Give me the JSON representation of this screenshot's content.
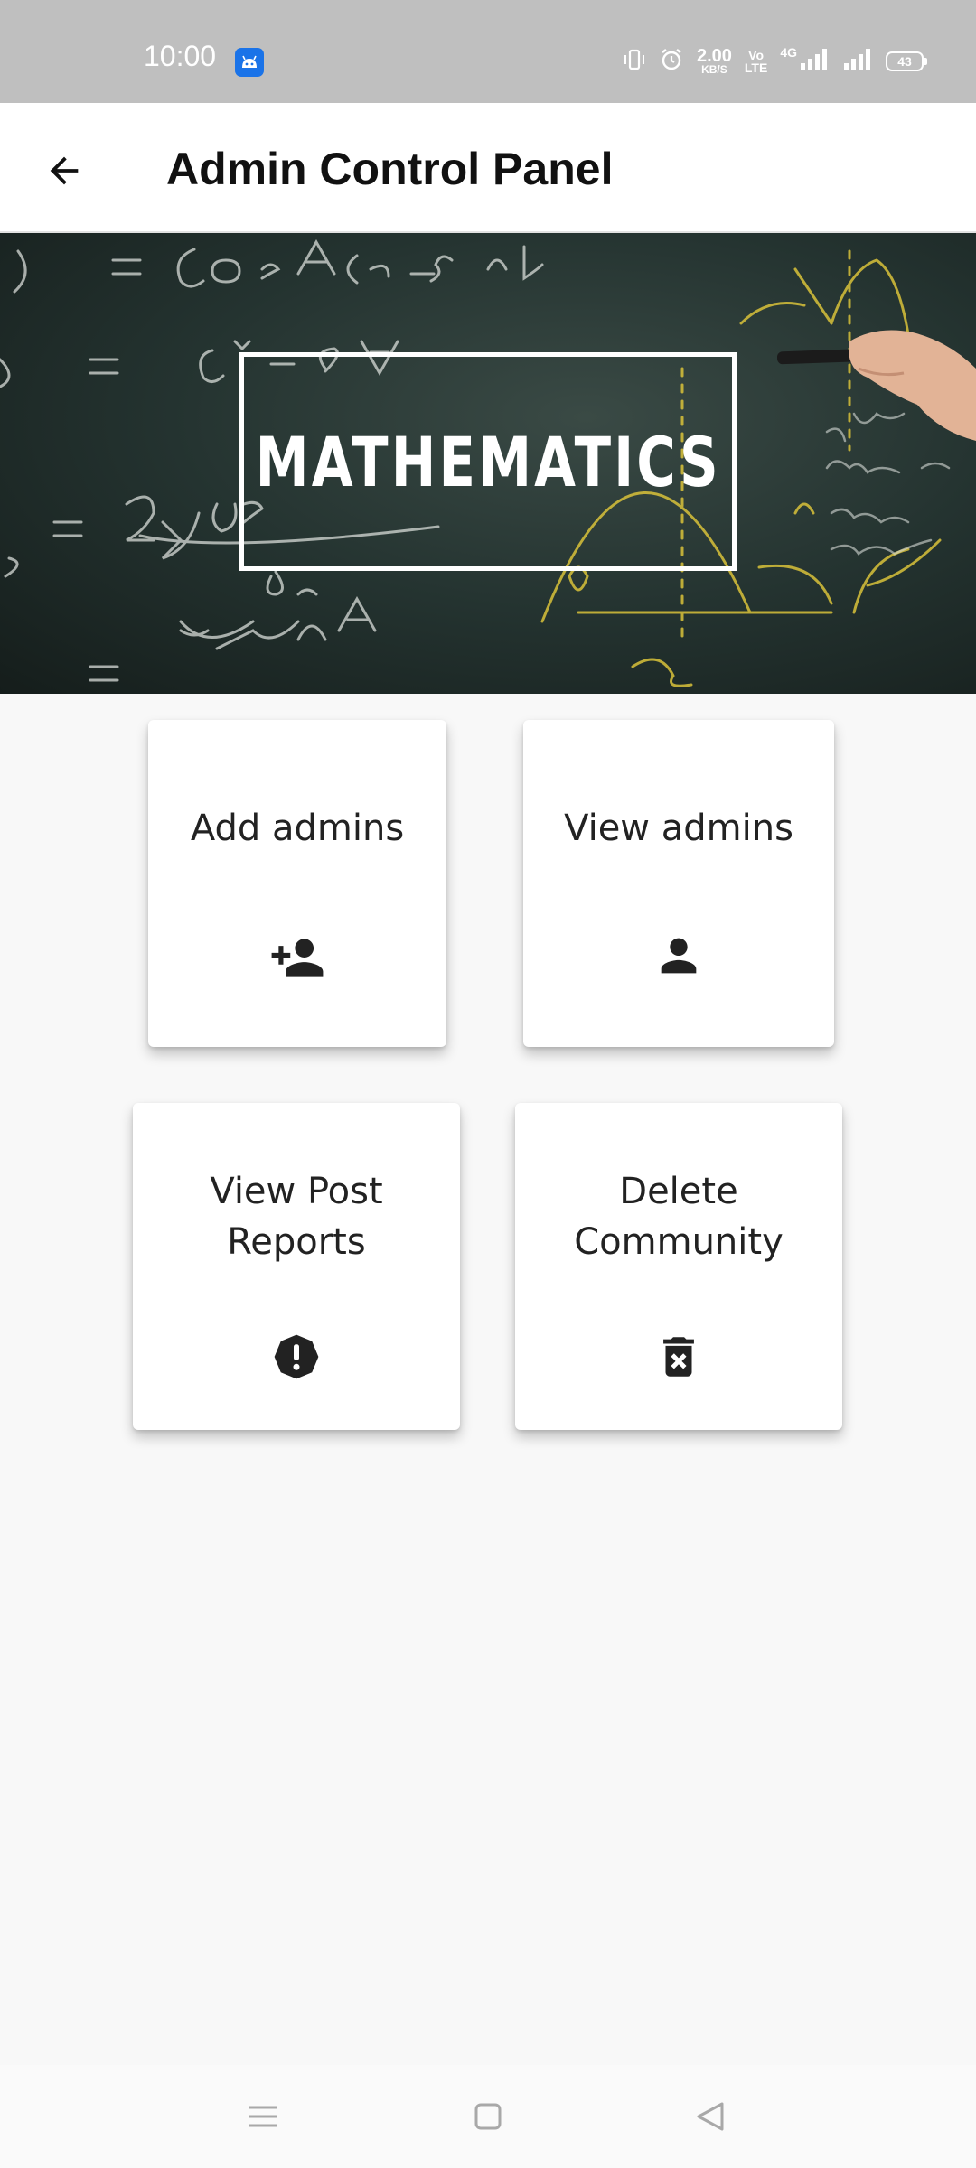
{
  "status_bar": {
    "time": "10:00",
    "speed_value": "2.00",
    "speed_unit": "KB/S",
    "volte_top": "Vo",
    "volte_bottom": "LTE",
    "network": "4G",
    "battery": "43"
  },
  "app_bar": {
    "title": "Admin Control Panel",
    "back_icon": "arrow-left-icon"
  },
  "banner": {
    "title": "MATHEMATICS"
  },
  "cards": [
    {
      "label": "Add admins",
      "icon": "person-add-icon"
    },
    {
      "label": "View admins",
      "icon": "person-icon"
    },
    {
      "label_line1": "View Post",
      "label_line2": "Reports",
      "icon": "report-icon"
    },
    {
      "label_line1": "Delete",
      "label_line2": "Community",
      "icon": "delete-forever-icon"
    }
  ],
  "colors": {
    "status_bar": "#bfbfbf",
    "app_bar": "#ffffff",
    "page_background": "#f8f8f8",
    "icon": "#222222"
  }
}
